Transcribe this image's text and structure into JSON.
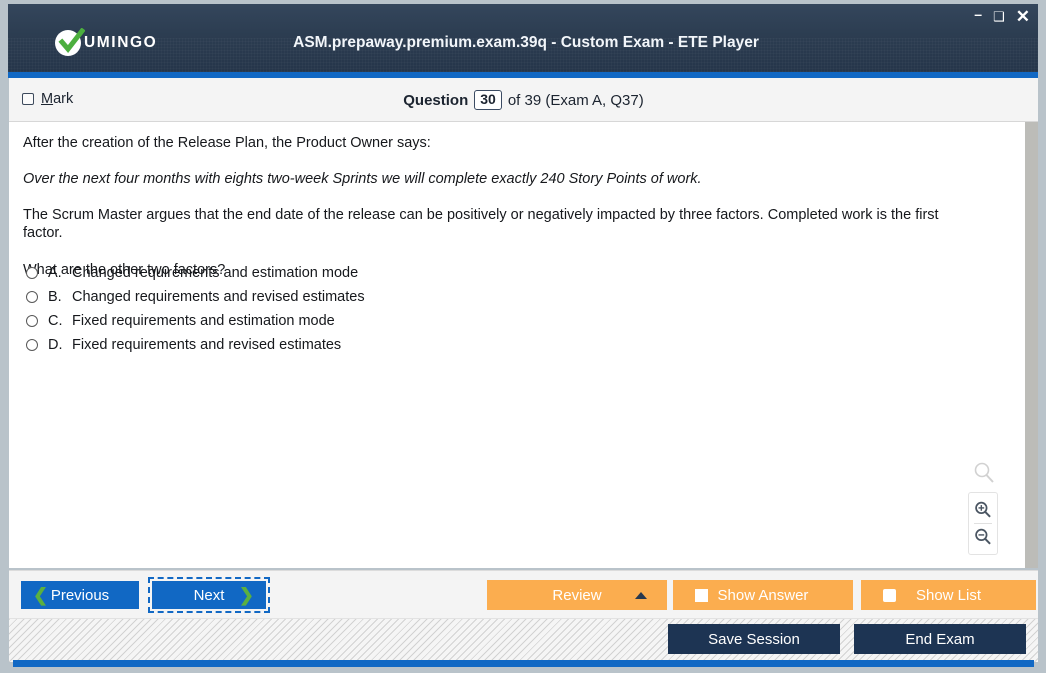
{
  "window": {
    "title": "ASM.prepaway.premium.exam.39q - Custom Exam - ETE Player",
    "logo_text": "UMINGO",
    "controls": {
      "minimize": "–",
      "maximize": "❑",
      "close": "✕"
    }
  },
  "question_bar": {
    "mark_label_prefix": "",
    "mark_label_accel": "M",
    "mark_label_rest": "ark",
    "mark_checked": false,
    "question_word": "Question",
    "question_number": "30",
    "question_rest": "of 39 (Exam A, Q37)"
  },
  "question": {
    "paragraphs": [
      {
        "text": "After the creation of the Release Plan, the Product Owner says:",
        "italic": false
      },
      {
        "text": "Over the next four months with eights two-week Sprints we will complete exactly 240 Story Points of work.",
        "italic": true
      },
      {
        "text": "The Scrum Master argues that the end date of the release can be positively or negatively impacted by three factors. Completed work is the first factor.",
        "italic": false
      },
      {
        "text": "What are the other two factors?",
        "italic": false
      }
    ],
    "options": [
      {
        "letter": "A.",
        "text": "Changed requirements and estimation mode",
        "selected": false
      },
      {
        "letter": "B.",
        "text": "Changed requirements and revised estimates",
        "selected": false
      },
      {
        "letter": "C.",
        "text": "Fixed requirements and estimation mode",
        "selected": false
      },
      {
        "letter": "D.",
        "text": "Fixed requirements and revised estimates",
        "selected": false
      }
    ]
  },
  "zoom_controls": {
    "ghost_icon": "magnifier-icon",
    "zoom_in_icon": "zoom-in-icon",
    "zoom_out_icon": "zoom-out-icon"
  },
  "toolbar": {
    "previous_label": "Previous",
    "next_label": "Next",
    "review_label": "Review",
    "show_answer_label": "Show Answer",
    "show_list_label": "Show List"
  },
  "footer": {
    "save_session_label": "Save Session",
    "end_exam_label": "End Exam"
  },
  "colors": {
    "header_dark": "#2c3d51",
    "accent_blue": "#1168c4",
    "orange": "#fbad4f",
    "navy_button": "#1d3453",
    "chevron_green": "#5ab040",
    "window_frame": "#b9c3ca"
  }
}
